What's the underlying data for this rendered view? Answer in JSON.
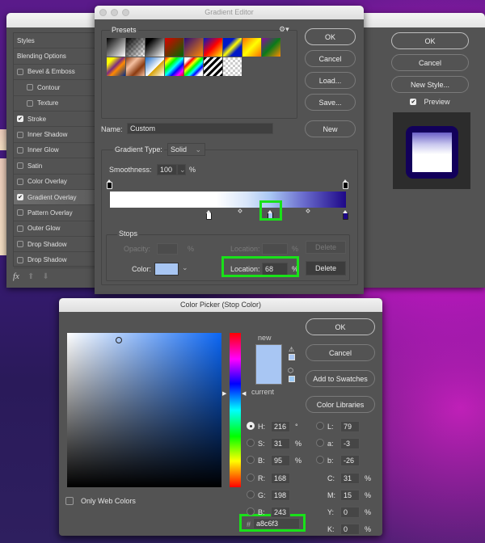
{
  "layer_style": {
    "list": [
      {
        "label": "Styles",
        "checkbox": false,
        "checked": false,
        "sub": false,
        "active": false
      },
      {
        "label": "Blending Options",
        "checkbox": false,
        "checked": false,
        "sub": false,
        "active": false
      },
      {
        "label": "Bevel & Emboss",
        "checkbox": true,
        "checked": false,
        "sub": false,
        "active": false
      },
      {
        "label": "Contour",
        "checkbox": true,
        "checked": false,
        "sub": true,
        "active": false
      },
      {
        "label": "Texture",
        "checkbox": true,
        "checked": false,
        "sub": true,
        "active": false
      },
      {
        "label": "Stroke",
        "checkbox": true,
        "checked": true,
        "sub": false,
        "active": false
      },
      {
        "label": "Inner Shadow",
        "checkbox": true,
        "checked": false,
        "sub": false,
        "active": false
      },
      {
        "label": "Inner Glow",
        "checkbox": true,
        "checked": false,
        "sub": false,
        "active": false
      },
      {
        "label": "Satin",
        "checkbox": true,
        "checked": false,
        "sub": false,
        "active": false
      },
      {
        "label": "Color Overlay",
        "checkbox": true,
        "checked": false,
        "sub": false,
        "active": false
      },
      {
        "label": "Gradient Overlay",
        "checkbox": true,
        "checked": true,
        "sub": false,
        "active": true
      },
      {
        "label": "Pattern Overlay",
        "checkbox": true,
        "checked": false,
        "sub": false,
        "active": false
      },
      {
        "label": "Outer Glow",
        "checkbox": true,
        "checked": false,
        "sub": false,
        "active": false
      },
      {
        "label": "Drop Shadow",
        "checkbox": true,
        "checked": false,
        "sub": false,
        "active": false
      },
      {
        "label": "Drop Shadow",
        "checkbox": true,
        "checked": false,
        "sub": false,
        "active": false
      }
    ],
    "fx_label": "fx",
    "buttons": {
      "ok": "OK",
      "cancel": "Cancel",
      "new_style": "New Style..."
    },
    "preview_label": "Preview",
    "preview_checked": true
  },
  "gradient_editor": {
    "title": "Gradient Editor",
    "presets_label": "Presets",
    "buttons": {
      "ok": "OK",
      "cancel": "Cancel",
      "load": "Load...",
      "save": "Save...",
      "new": "New"
    },
    "name_label": "Name:",
    "name_value": "Custom",
    "gradient_type_label": "Gradient Type:",
    "gradient_type_value": "Solid",
    "smoothness_label": "Smoothness:",
    "smoothness_value": "100",
    "percent": "%",
    "stops_label": "Stops",
    "opacity_label": "Opacity:",
    "opacity_location_label": "Location:",
    "delete_label": "Delete",
    "color_label": "Color:",
    "location_label": "Location:",
    "location_value": "68",
    "stop_color": "#a8c6f3",
    "color_stops": [
      {
        "location": 42,
        "color": "#ffffff"
      },
      {
        "location": 68,
        "color": "#a8c6f3",
        "selected": true
      },
      {
        "location": 100,
        "color": "#1e0888"
      }
    ],
    "opacity_stops": [
      {
        "location": 0,
        "color": "#000000"
      },
      {
        "location": 100,
        "color": "#000000"
      }
    ],
    "midpoints": [
      55,
      84
    ],
    "highlight_color": "#19e119"
  },
  "color_picker": {
    "title": "Color Picker (Stop Color)",
    "new_label": "new",
    "current_label": "current",
    "new_color": "#a8c6f3",
    "current_color": "#a8c6f3",
    "buttons": {
      "ok": "OK",
      "cancel": "Cancel",
      "add_swatches": "Add to Swatches",
      "color_libraries": "Color Libraries"
    },
    "fields": {
      "H": {
        "label": "H:",
        "value": "216",
        "unit": "°"
      },
      "S": {
        "label": "S:",
        "value": "31",
        "unit": "%"
      },
      "B": {
        "label": "B:",
        "value": "95",
        "unit": "%"
      },
      "R": {
        "label": "R:",
        "value": "168"
      },
      "G": {
        "label": "G:",
        "value": "198"
      },
      "Bl": {
        "label": "B:",
        "value": "243"
      },
      "L": {
        "label": "L:",
        "value": "79"
      },
      "a": {
        "label": "a:",
        "value": "-3"
      },
      "b": {
        "label": "b:",
        "value": "-26"
      },
      "C": {
        "label": "C:",
        "value": "31",
        "unit": "%"
      },
      "M": {
        "label": "M:",
        "value": "15",
        "unit": "%"
      },
      "Y": {
        "label": "Y:",
        "value": "0",
        "unit": "%"
      },
      "K": {
        "label": "K:",
        "value": "0",
        "unit": "%"
      }
    },
    "hex_label": "#",
    "hex_value": "a8c6f3",
    "only_web_colors": "Only Web Colors"
  }
}
